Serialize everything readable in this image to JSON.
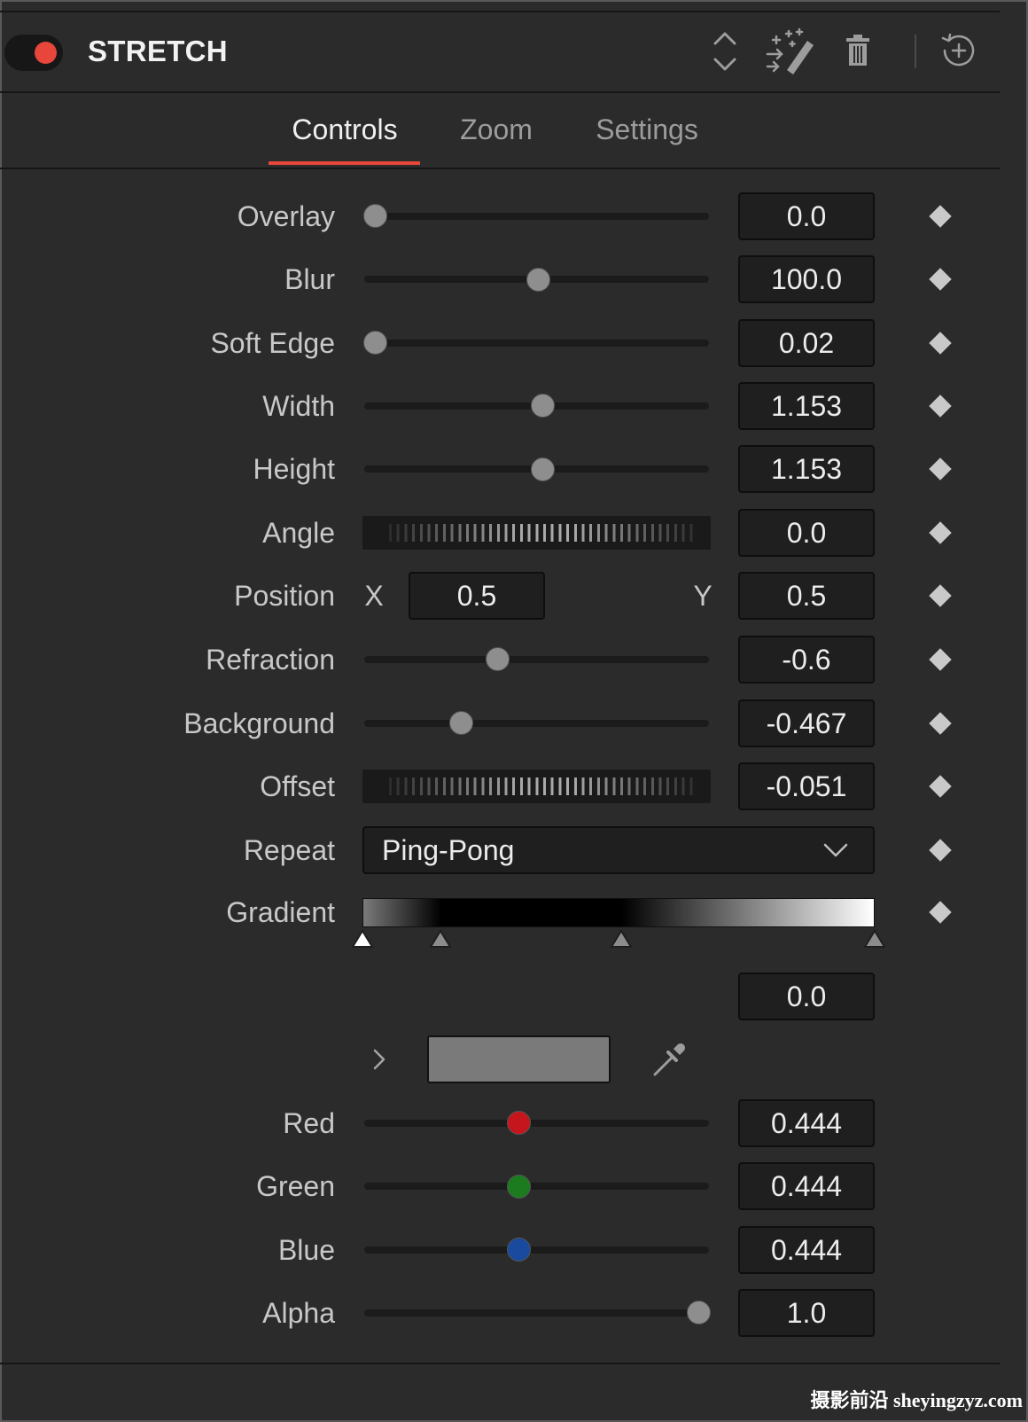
{
  "header": {
    "title": "STRETCH",
    "enabled": true,
    "icons": {
      "toggle": "power-toggle-icon",
      "collapse": "expand-collapse-icon",
      "magic": "magic-wand-icon",
      "delete": "trash-icon",
      "reset": "reset-icon"
    }
  },
  "tabs": [
    {
      "label": "Controls",
      "active": true
    },
    {
      "label": "Zoom",
      "active": false
    },
    {
      "label": "Settings",
      "active": false
    }
  ],
  "controls": {
    "overlay": {
      "label": "Overlay",
      "value": "0.0",
      "level": 0
    },
    "blur": {
      "label": "Blur",
      "value": "100.0",
      "level": 0.506
    },
    "soft_edge": {
      "label": "Soft Edge",
      "value": "0.02",
      "level": 0
    },
    "width": {
      "label": "Width",
      "value": "1.153",
      "level": 0.52
    },
    "height": {
      "label": "Height",
      "value": "1.153",
      "level": 0.52
    },
    "angle": {
      "label": "Angle",
      "value": "0.0"
    },
    "position": {
      "label": "Position",
      "x_label": "X",
      "x_value": "0.5",
      "y_label": "Y",
      "y_value": "0.5"
    },
    "refraction": {
      "label": "Refraction",
      "value": "-0.6",
      "level": 0.379
    },
    "background": {
      "label": "Background",
      "value": "-0.467",
      "level": 0.268
    },
    "offset": {
      "label": "Offset",
      "value": "-0.051"
    },
    "repeat": {
      "label": "Repeat",
      "selected": "Ping-Pong",
      "icon": "chevron-down-icon"
    },
    "gradient": {
      "label": "Gradient",
      "selected_stop": 0,
      "stop_position_value": "0.0",
      "stops": [
        {
          "position": 0,
          "color": "#7a7a7a"
        },
        {
          "position": 0.152,
          "color": "#000000"
        },
        {
          "position": 0.506,
          "color": "#000000"
        },
        {
          "position": 1,
          "color": "#ffffff"
        }
      ]
    }
  },
  "color": {
    "swatch": "#7a7a7a",
    "expand_icon": "chevron-right-icon",
    "picker_icon": "eyedropper-icon",
    "red": {
      "label": "Red",
      "value": "0.444",
      "level": 0.444,
      "thumb_color": "#c4161c"
    },
    "green": {
      "label": "Green",
      "value": "0.444",
      "level": 0.444,
      "thumb_color": "#1c7a1f"
    },
    "blue": {
      "label": "Blue",
      "value": "0.444",
      "level": 0.444,
      "thumb_color": "#1a4a9e"
    },
    "alpha": {
      "label": "Alpha",
      "value": "1.0",
      "level": 1.0,
      "thumb_color": "#8e8e8e"
    }
  },
  "colors": {
    "accent": "#e8463a",
    "panel": "#2b2b2b",
    "keyframe": "#c9c9c9"
  },
  "keyframe_icon": "keyframe-diamond-icon",
  "watermark": "摄影前沿 sheyingzyz.com"
}
